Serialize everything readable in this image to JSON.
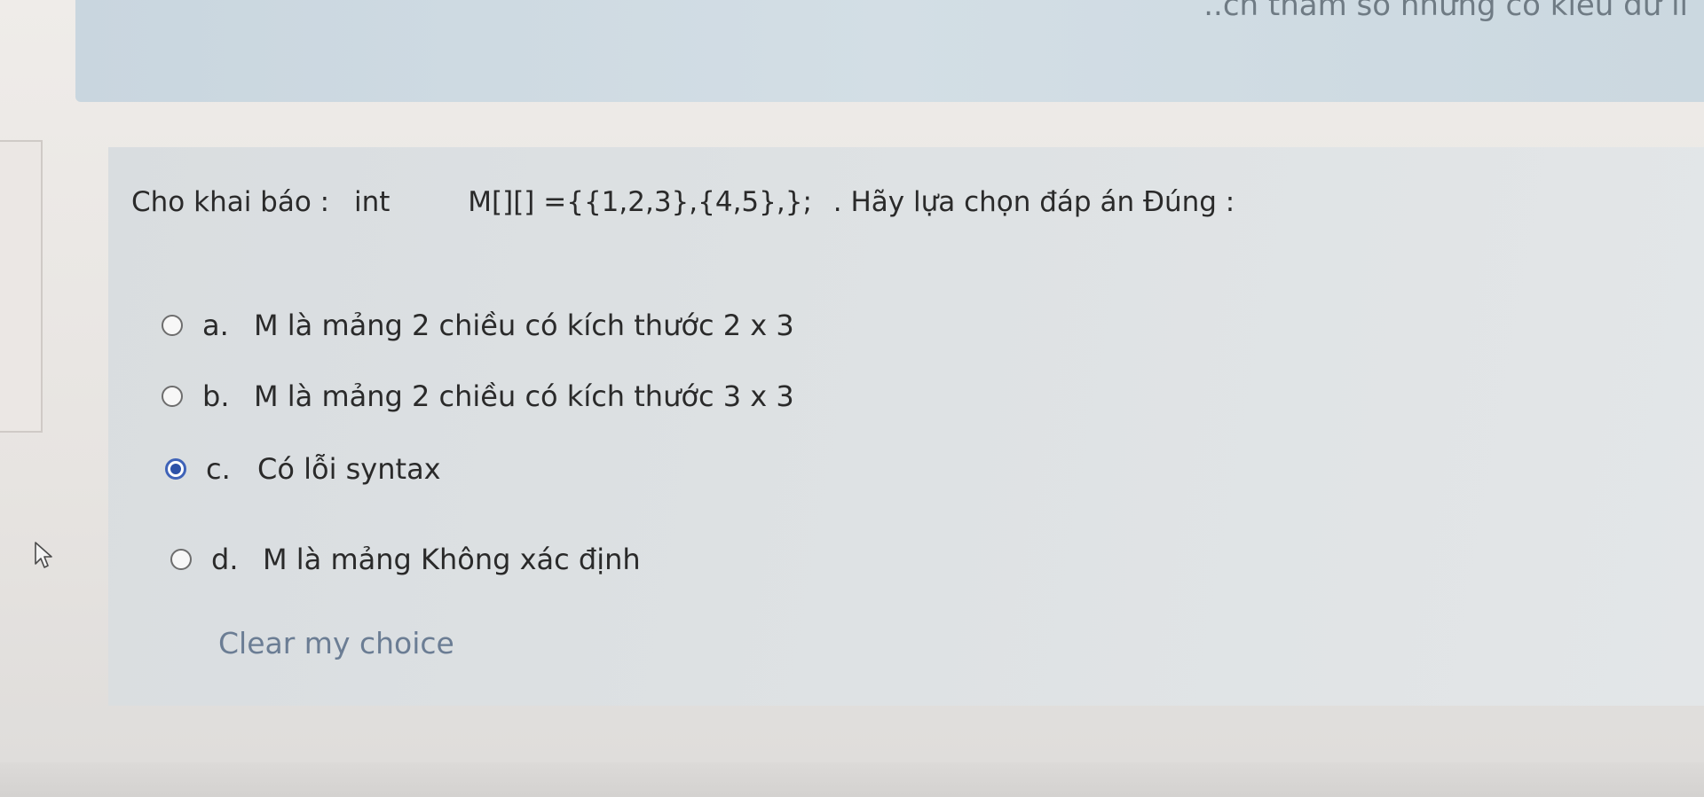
{
  "previous_card": {
    "text": "..ch tham số nhưng có kiểu dữ li"
  },
  "question": {
    "intro": "Cho khai báo :",
    "type_keyword": "int",
    "declaration": "M[][] ={{1,2,3},{4,5},};",
    "instruction": ". Hãy lựa chọn đáp án Đúng :"
  },
  "options": [
    {
      "letter": "a.",
      "text": "M là mảng 2 chiều có kích thước 2 x 3",
      "selected": false
    },
    {
      "letter": "b.",
      "text": "M là mảng 2 chiều có kích thước 3 x 3",
      "selected": false
    },
    {
      "letter": "c.",
      "text": "Có lỗi syntax",
      "selected": true
    },
    {
      "letter": "d.",
      "text": "M là mảng Không xác định",
      "selected": false
    }
  ],
  "clear_choice_label": "Clear my choice",
  "colors": {
    "radio_selected": "#2d52a8",
    "link": "#6b7d94"
  }
}
